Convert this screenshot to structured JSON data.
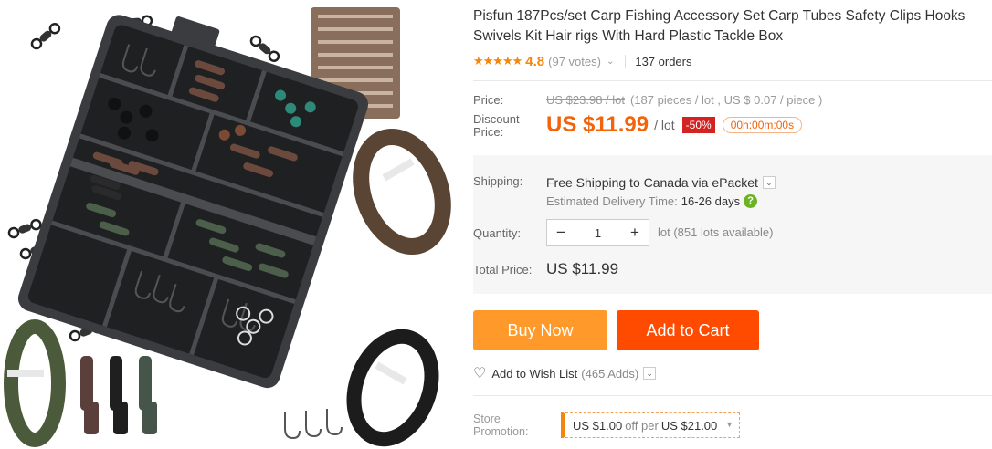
{
  "product": {
    "title": "Pisfun 187Pcs/set Carp Fishing Accessory Set Carp Tubes Safety Clips Hooks Swivels Kit Hair rigs With Hard Plastic Tackle Box",
    "stars": "★★★★★",
    "rating": "4.8",
    "votes": "(97 votes)",
    "orders": "137 orders"
  },
  "price": {
    "label": "Price:",
    "old_price": "US $23.98 / lot",
    "old_detail": "(187 pieces / lot , US $ 0.07 / piece )",
    "discount_label": "Discount Price:",
    "discount_price": "US $11.99",
    "per": "/ lot",
    "off_badge": "-50%",
    "timer": "00h:00m:00s"
  },
  "shipping": {
    "label": "Shipping:",
    "value": "Free Shipping to Canada via ePacket",
    "eta_label": "Estimated Delivery Time:",
    "eta_days": "16-26 days",
    "help_icon": "?"
  },
  "quantity": {
    "label": "Quantity:",
    "minus": "−",
    "value": "1",
    "plus": "+",
    "note": "lot (851 lots available)"
  },
  "total": {
    "label": "Total Price:",
    "value": "US $11.99"
  },
  "buttons": {
    "buy_now": "Buy Now",
    "add_to_cart": "Add to Cart"
  },
  "wishlist": {
    "label": "Add to Wish List",
    "adds": "(465 Adds)"
  },
  "promotion": {
    "label": "Store Promotion:",
    "amount": "US $1.00",
    "off_text": "off per",
    "threshold": "US $21.00"
  },
  "colors": {
    "accent_orange": "#f3860d",
    "price_orange": "#f3630a",
    "buy_now": "#ff9a2a",
    "add_to_cart": "#ff4b00",
    "badge_red": "#d22222",
    "help_green": "#6bb324"
  },
  "icons": {
    "rating": "star-icon",
    "dropdown": "chevron-down-icon",
    "wishlist": "heart-outline-icon",
    "help": "question-circle-icon"
  }
}
